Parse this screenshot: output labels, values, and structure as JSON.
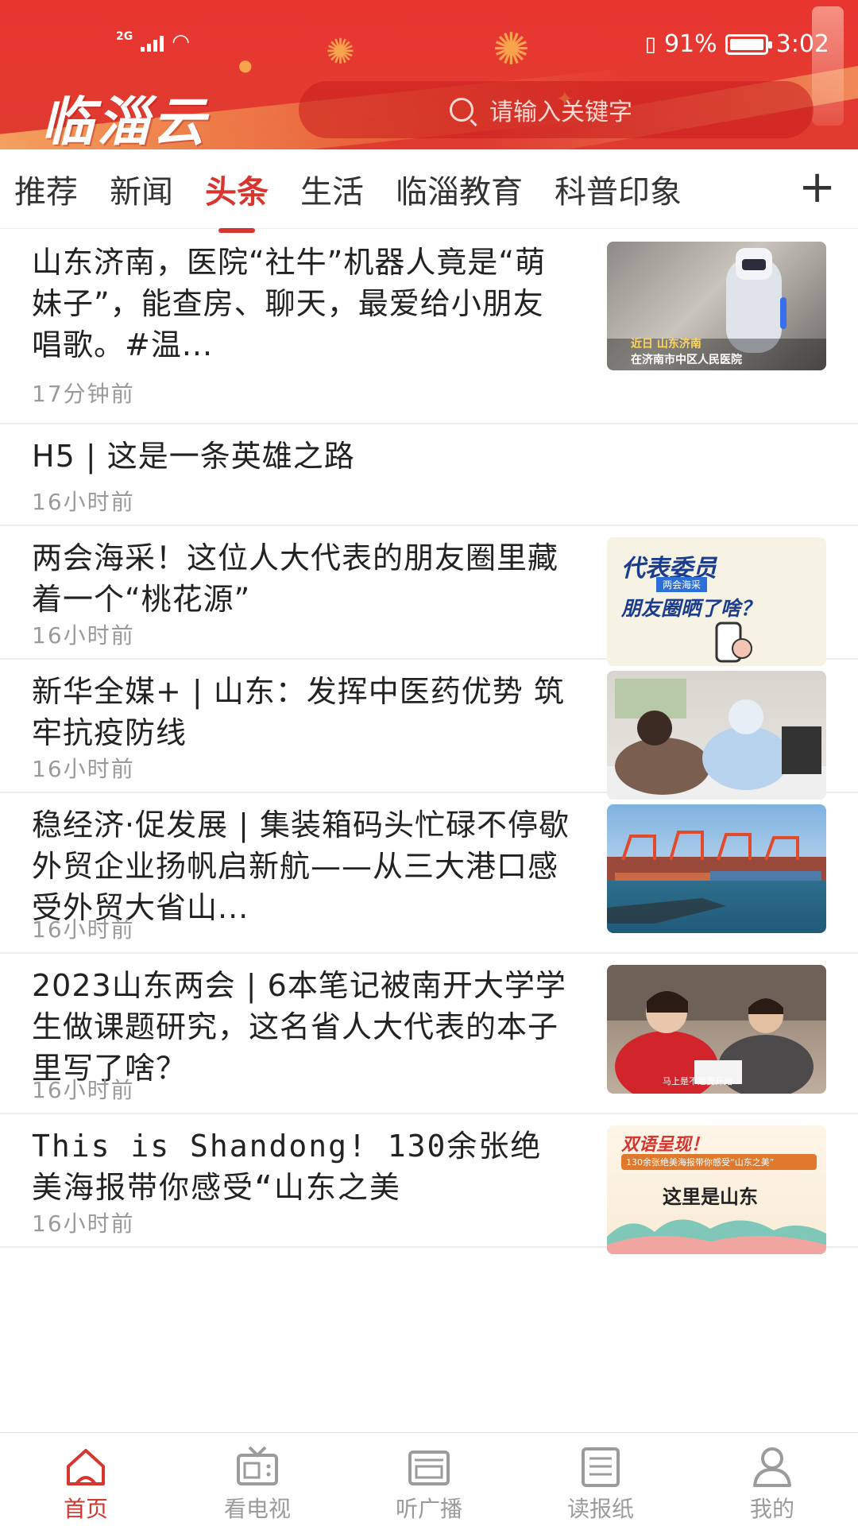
{
  "status_bar": {
    "network": "2G",
    "battery": "91%",
    "time": "3:02"
  },
  "header": {
    "logo_text": "临淄云",
    "search_placeholder": "请输入关键字"
  },
  "tabs": [
    "推荐",
    "新闻",
    "头条",
    "生活",
    "临淄教育",
    "科普印象"
  ],
  "active_tab": "头条",
  "feed": [
    {
      "title": "山东济南，医院“社牛”机器人竟是“萌妹子”，能查房、聊天，最爱给小朋友唱歌。#温...",
      "time": "17分钟前",
      "thumb_caption1": "近日 山东济南",
      "thumb_caption2": "在济南市中区人民医院"
    },
    {
      "title": "H5 | 这是一条英雄之路",
      "time": "16小时前"
    },
    {
      "title": "两会海采！这位人大代表的朋友圈里藏着一个“桃花源”",
      "time": "16小时前",
      "thumb_line1": "代表委员",
      "thumb_tag": "两会海采",
      "thumb_line2": "朋友圈晒了啥？"
    },
    {
      "title": "新华全媒+ | 山东：发挥中医药优势 筑牢抗疫防线",
      "time": "16小时前"
    },
    {
      "title": "稳经济·促发展 | 集装箱码头忙碌不停歇外贸企业扬帆启新航——从三大港口感受外贸大省山...",
      "time": "16小时前"
    },
    {
      "title": "2023山东两会 | 6本笔记被南开大学学生做课题研究，这名省人大代表的本子里写了啥？",
      "time": "16小时前",
      "thumb_caption": "马上是不是要开始..."
    },
    {
      "title": "This is Shandong! 130余张绝美海报带你感受“山东之美",
      "time": "16小时前",
      "thumb_line1": "双语呈现！",
      "thumb_line2": "130余张绝美海报带你感受“山东之美”",
      "thumb_line3": "这里是山东"
    }
  ],
  "bottom_nav": [
    "首页",
    "看电视",
    "听广播",
    "读报纸",
    "我的"
  ],
  "colors": {
    "brand": "#d8352e",
    "header": "#e43a30"
  }
}
